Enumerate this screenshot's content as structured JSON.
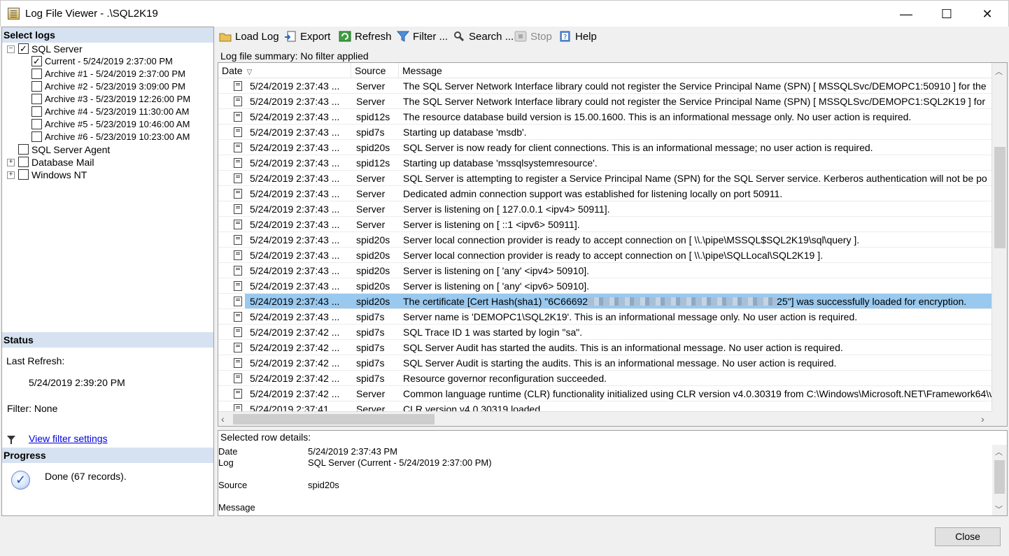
{
  "window": {
    "title": "Log File Viewer - .\\SQL2K19",
    "min_glyph": "—",
    "max_glyph": "☐",
    "close_glyph": "✕"
  },
  "left": {
    "select_logs_header": "Select logs",
    "tree": [
      {
        "label": "SQL Server",
        "checked": true,
        "expander": "minus"
      },
      {
        "label": "Current - 5/24/2019 2:37:00 PM",
        "checked": true
      },
      {
        "label": "Archive #1 - 5/24/2019 2:37:00 PM",
        "checked": false
      },
      {
        "label": "Archive #2 - 5/23/2019 3:09:00 PM",
        "checked": false
      },
      {
        "label": "Archive #3 - 5/23/2019 12:26:00 PM",
        "checked": false
      },
      {
        "label": "Archive #4 - 5/23/2019 11:30:00 AM",
        "checked": false
      },
      {
        "label": "Archive #5 - 5/23/2019 10:46:00 AM",
        "checked": false
      },
      {
        "label": "Archive #6 - 5/23/2019 10:23:00 AM",
        "checked": false
      },
      {
        "label": "SQL Server Agent",
        "checked": false
      },
      {
        "label": "Database Mail",
        "checked": false,
        "expander": "plus"
      },
      {
        "label": "Windows NT",
        "checked": false,
        "expander": "plus"
      }
    ],
    "status_header": "Status",
    "last_refresh_label": "Last Refresh:",
    "last_refresh_value": "5/24/2019 2:39:20 PM",
    "filter_text": "Filter: None",
    "view_filter_link": "View filter settings",
    "progress_header": "Progress",
    "progress_text": "Done (67 records)."
  },
  "toolbar": {
    "load_log": "Load Log",
    "export": "Export",
    "refresh": "Refresh",
    "filter": "Filter ...",
    "search": "Search ...",
    "stop": "Stop",
    "help": "Help"
  },
  "summary": "Log file summary: No filter applied",
  "grid": {
    "headers": {
      "date": "Date",
      "source": "Source",
      "message": "Message"
    },
    "rows": [
      {
        "date": "5/24/2019 2:37:43 ...",
        "source": "Server",
        "message": "The SQL Server Network Interface library could not register the Service Principal Name (SPN) [ MSSQLSvc/DEMOPC1:50910 ] for the"
      },
      {
        "date": "5/24/2019 2:37:43 ...",
        "source": "Server",
        "message": "The SQL Server Network Interface library could not register the Service Principal Name (SPN) [ MSSQLSvc/DEMOPC1:SQL2K19 ] for"
      },
      {
        "date": "5/24/2019 2:37:43 ...",
        "source": "spid12s",
        "message": "The resource database build version is 15.00.1600. This is an informational message only. No user action is required."
      },
      {
        "date": "5/24/2019 2:37:43 ...",
        "source": "spid7s",
        "message": "Starting up database 'msdb'."
      },
      {
        "date": "5/24/2019 2:37:43 ...",
        "source": "spid20s",
        "message": "SQL Server is now ready for client connections. This is an informational message; no user action is required."
      },
      {
        "date": "5/24/2019 2:37:43 ...",
        "source": "spid12s",
        "message": "Starting up database 'mssqlsystemresource'."
      },
      {
        "date": "5/24/2019 2:37:43 ...",
        "source": "Server",
        "message": "SQL Server is attempting to register a Service Principal Name (SPN) for the SQL Server service. Kerberos authentication will not be po"
      },
      {
        "date": "5/24/2019 2:37:43 ...",
        "source": "Server",
        "message": "Dedicated admin connection support was established for listening locally on port 50911."
      },
      {
        "date": "5/24/2019 2:37:43 ...",
        "source": "Server",
        "message": "Server is listening on [ 127.0.0.1 <ipv4> 50911]."
      },
      {
        "date": "5/24/2019 2:37:43 ...",
        "source": "Server",
        "message": "Server is listening on [ ::1 <ipv6> 50911]."
      },
      {
        "date": "5/24/2019 2:37:43 ...",
        "source": "spid20s",
        "message": "Server local connection provider is ready to accept connection on [ \\\\.\\pipe\\MSSQL$SQL2K19\\sql\\query ]."
      },
      {
        "date": "5/24/2019 2:37:43 ...",
        "source": "spid20s",
        "message": "Server local connection provider is ready to accept connection on [ \\\\.\\pipe\\SQLLocal\\SQL2K19 ]."
      },
      {
        "date": "5/24/2019 2:37:43 ...",
        "source": "spid20s",
        "message": "Server is listening on [ 'any' <ipv4> 50910]."
      },
      {
        "date": "5/24/2019 2:37:43 ...",
        "source": "spid20s",
        "message": "Server is listening on [ 'any' <ipv6> 50910]."
      },
      {
        "date": "5/24/2019 2:37:43 ...",
        "source": "spid20s",
        "message_pre": "The certificate [Cert Hash(sha1) \"6C66692",
        "message_post": "25\"] was successfully loaded for encryption.",
        "selected": true
      },
      {
        "date": "5/24/2019 2:37:43 ...",
        "source": "spid7s",
        "message": "Server name is 'DEMOPC1\\SQL2K19'. This is an informational message only. No user action is required."
      },
      {
        "date": "5/24/2019 2:37:42 ...",
        "source": "spid7s",
        "message": "SQL Trace ID 1 was started by login \"sa\"."
      },
      {
        "date": "5/24/2019 2:37:42 ...",
        "source": "spid7s",
        "message": "SQL Server Audit has started the audits. This is an informational message. No user action is required."
      },
      {
        "date": "5/24/2019 2:37:42 ...",
        "source": "spid7s",
        "message": "SQL Server Audit is starting the audits. This is an informational message. No user action is required."
      },
      {
        "date": "5/24/2019 2:37:42 ...",
        "source": "spid7s",
        "message": "Resource governor reconfiguration succeeded."
      },
      {
        "date": "5/24/2019 2:37:42 ...",
        "source": "Server",
        "message": "Common language runtime (CLR) functionality initialized using CLR version v4.0.30319 from C:\\Windows\\Microsoft.NET\\Framework64\\v"
      },
      {
        "date": "5/24/2019 2:37:41 ...",
        "source": "Server",
        "message": "CLR version v4.0.30319 loaded."
      }
    ]
  },
  "details": {
    "title": "Selected row details:",
    "date_label": "Date",
    "date_value": "5/24/2019 2:37:43 PM",
    "log_label": "Log",
    "log_value": "SQL Server (Current - 5/24/2019 2:37:00 PM)",
    "source_label": "Source",
    "source_value": "spid20s",
    "message_label": "Message"
  },
  "close_button": "Close",
  "colors": {
    "selection": "#99c9ef",
    "section_header": "#d6e2f1",
    "link": "#0000e0"
  }
}
